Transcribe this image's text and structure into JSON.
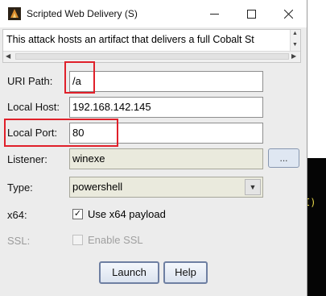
{
  "window": {
    "title": "Scripted Web Delivery (S)",
    "icon": "cobalt-strike-app-icon",
    "controls": [
      "minimize-icon",
      "maximize-icon",
      "close-icon"
    ]
  },
  "description": {
    "text": "This attack hosts an artifact that delivers a full Cobalt St"
  },
  "form": {
    "uri_path": {
      "label": "URI Path:",
      "value": "/a"
    },
    "local_host": {
      "label": "Local Host:",
      "value": "192.168.142.145"
    },
    "local_port": {
      "label": "Local Port:",
      "value": "80"
    },
    "listener": {
      "label": "Listener:",
      "value": "winexe",
      "browse_label": "..."
    },
    "type": {
      "label": "Type:",
      "value": "powershell"
    },
    "x64": {
      "label": "x64:",
      "checkbox_label": "Use x64 payload",
      "checked": true,
      "check_glyph": "✓"
    },
    "ssl": {
      "label": "SSL:",
      "checkbox_label": "Enable SSL",
      "checked": false
    }
  },
  "buttons": {
    "launch": "Launch",
    "help": "Help"
  },
  "background": {
    "terminal_glyph": "I)"
  },
  "colors": {
    "highlight": "#e0202a",
    "readonly_field": "#eaeadd",
    "button_border": "#6e7fa2"
  }
}
